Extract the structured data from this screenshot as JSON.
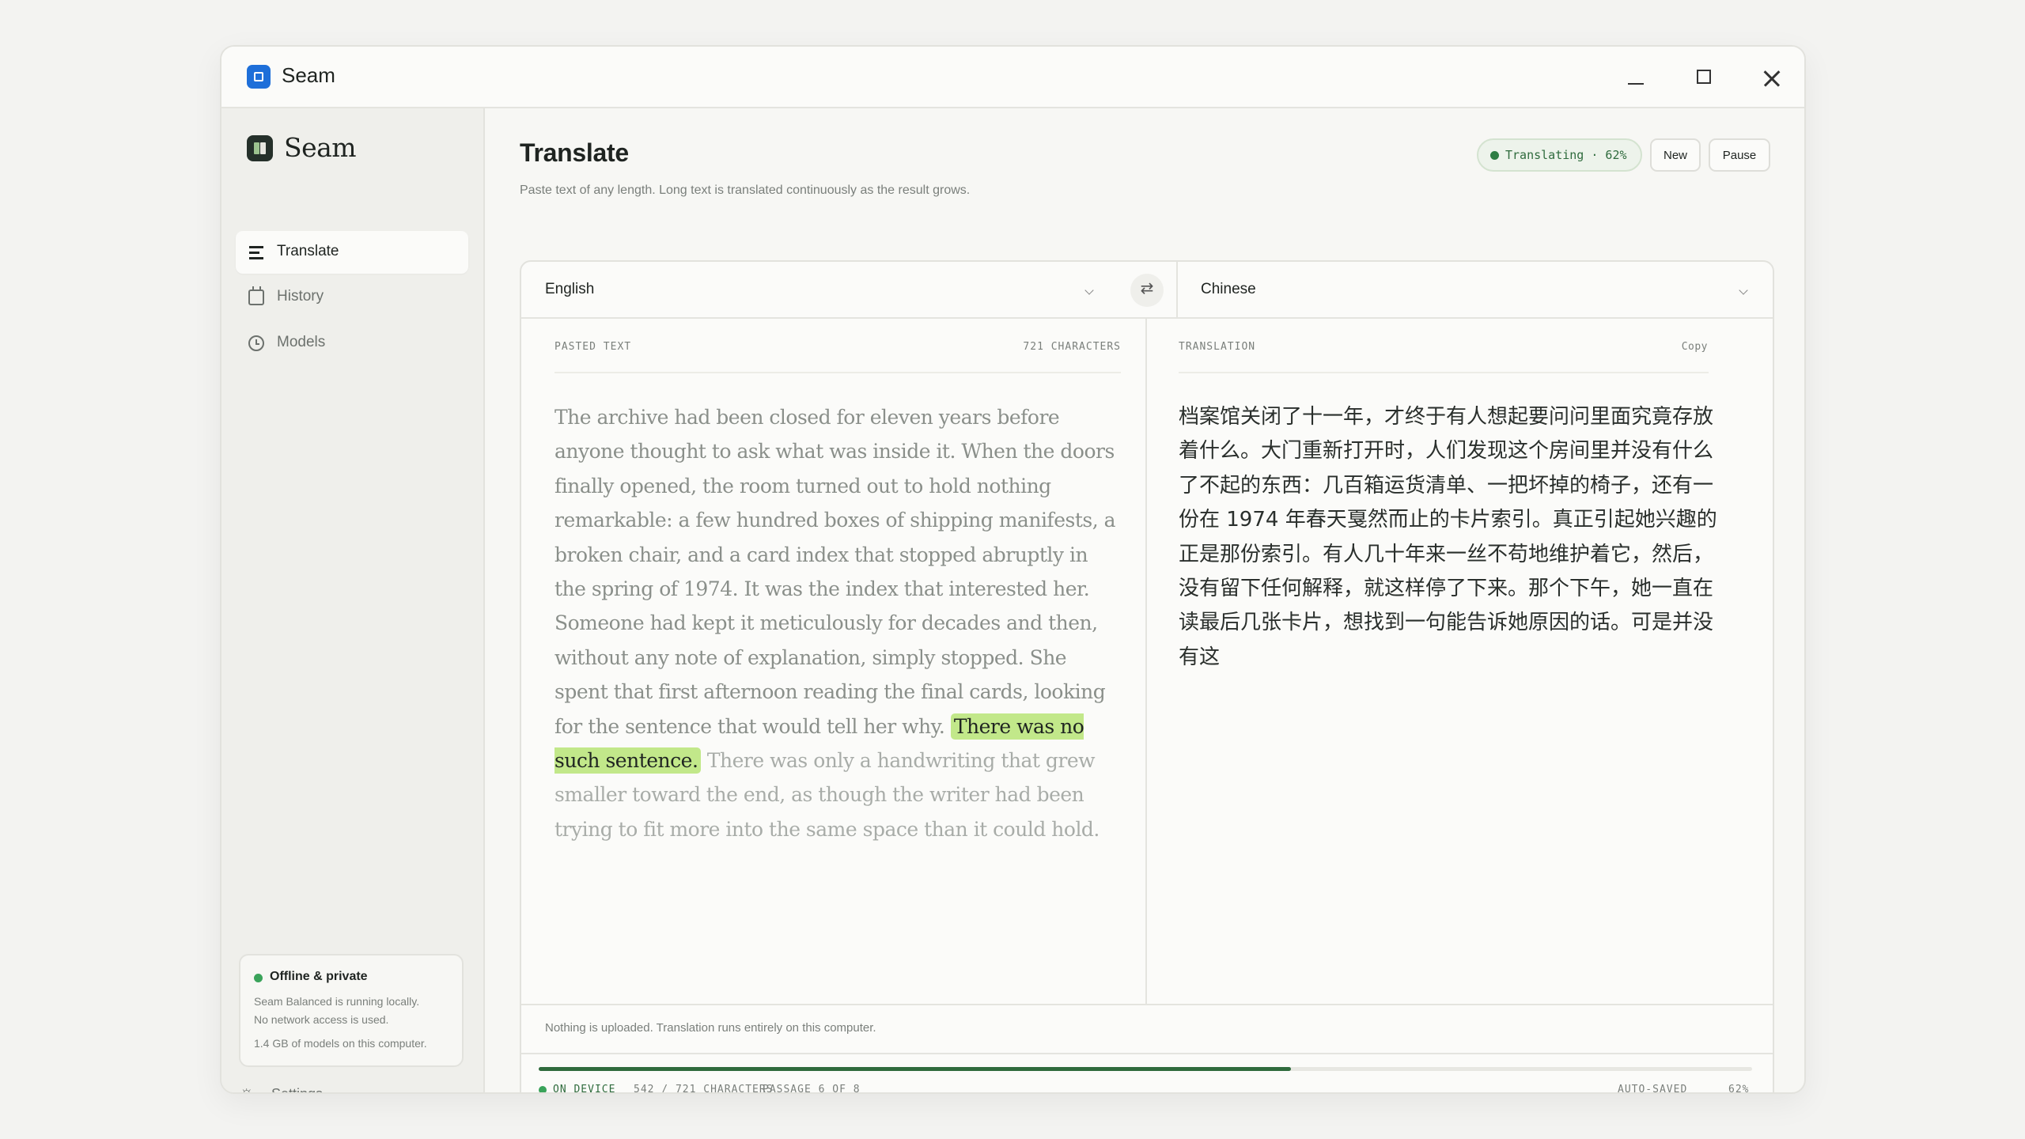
{
  "window": {
    "title": "Seam"
  },
  "sidebar": {
    "brand": "Seam",
    "items": [
      {
        "label": "Translate",
        "icon": "list-icon",
        "active": true
      },
      {
        "label": "History",
        "icon": "calendar-icon",
        "active": false
      },
      {
        "label": "Models",
        "icon": "clock-icon",
        "active": false
      }
    ],
    "status_card": {
      "title": "Offline & private",
      "line1": "Seam Balanced is running locally.",
      "line2": "No network access is used.",
      "line3": "1.4 GB of models on this computer."
    },
    "settings_label": "Settings"
  },
  "header": {
    "title": "Translate",
    "subtitle": "Paste text of any length. Long text is translated continuously as the result grows.",
    "status_pill": "Translating · 62%",
    "new_label": "New",
    "pause_label": "Pause"
  },
  "languages": {
    "source": "English",
    "target": "Chinese"
  },
  "source": {
    "header": "PASTED TEXT",
    "count": "721 CHARACTERS",
    "text_before": "The archive had been closed for eleven years before anyone thought to ask what was inside it. When the doors finally opened, the room turned out to hold nothing remarkable: a few hundred boxes of shipping manifests, a broken chair, and a card index that stopped abruptly in the spring of 1974. It was the index that interested her. Someone had kept it meticulously for decades and then, without any note of explanation, simply stopped. She spent that first afternoon reading the final cards, looking for the sentence that would tell her why.",
    "text_highlight": "There was no such sentence.",
    "text_after": "There was only a handwriting that grew smaller toward the end, as though the writer had been trying to fit more into the same space than it could hold."
  },
  "target": {
    "header": "TRANSLATION",
    "copy_label": "Copy",
    "text": "档案馆关闭了十一年，才终于有人想起要问问里面究竟存放着什么。大门重新打开时，人们发现这个房间里并没有什么了不起的东西：几百箱运货清单、一把坏掉的椅子，还有一份在 1974 年春天戛然而止的卡片索引。真正引起她兴趣的正是那份索引。有人几十年来一丝不苟地维护着它，然后，没有留下任何解释，就这样停了下来。那个下午，她一直在读最后几张卡片，想找到一句能告诉她原因的话。可是并没有这"
  },
  "footer": {
    "note": "Nothing is uploaded. Translation runs entirely on this computer.",
    "progress": 0.62,
    "on_device": "ON DEVICE",
    "chars": "542 / 721 CHARACTERS",
    "passage": "PASSAGE 6 OF 8",
    "autosaved": "AUTO-SAVED",
    "percent": "62%"
  },
  "colors": {
    "accent": "#2f6b3d",
    "highlight": "#c2e88a",
    "app_icon": "#1e6fd9",
    "status_dot": "#3aa35a"
  }
}
